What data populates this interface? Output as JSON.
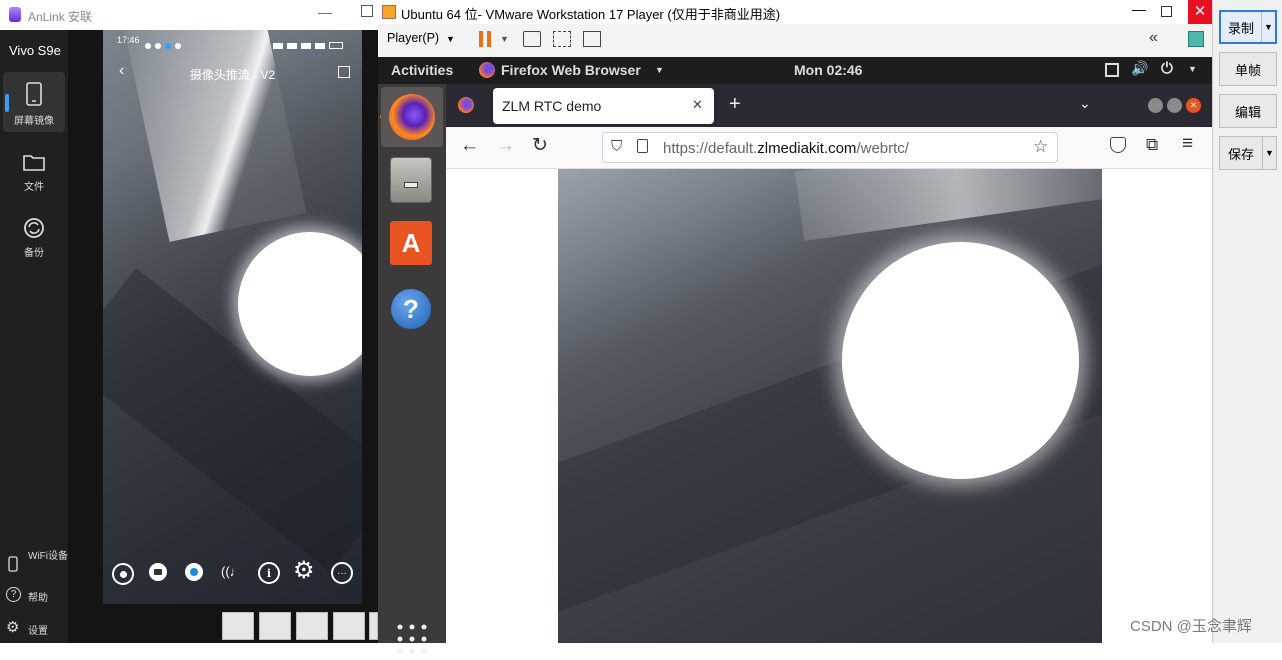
{
  "anlink": {
    "app_title": "AnLink 安联",
    "device_name": "Vivo S9e",
    "sidebar": {
      "items": [
        {
          "label": "屏幕镜像",
          "icon": "phone-icon"
        },
        {
          "label": "文件",
          "icon": "folder-icon"
        },
        {
          "label": "备份",
          "icon": "sync-icon"
        }
      ],
      "bottom": [
        {
          "label": "WiFi设备",
          "icon": "wifi-device-icon"
        },
        {
          "label": "帮助",
          "icon": "help-icon"
        },
        {
          "label": "设置",
          "icon": "gear-icon"
        }
      ]
    },
    "phone": {
      "status_time": "17:46",
      "app_header": "摄像头推流 - V2"
    }
  },
  "vmware": {
    "window_title": "Ubuntu 64 位- VMware Workstation 17 Player (仅用于非商业用途)",
    "player_menu": "Player(P)",
    "accent": "#e8711d"
  },
  "ubuntu": {
    "activities": "Activities",
    "app_menu": "Firefox Web Browser",
    "clock": "Mon 02:46"
  },
  "firefox": {
    "tab_title": "ZLM RTC demo",
    "url_prefix": "https://default.",
    "url_domain": "zlmediakit.com",
    "url_suffix": "/webrtc/"
  },
  "right_panel": {
    "record": "录制",
    "single_frame": "单帧",
    "edit": "编辑",
    "save": "保存"
  },
  "watermark": "CSDN @玉念聿辉"
}
